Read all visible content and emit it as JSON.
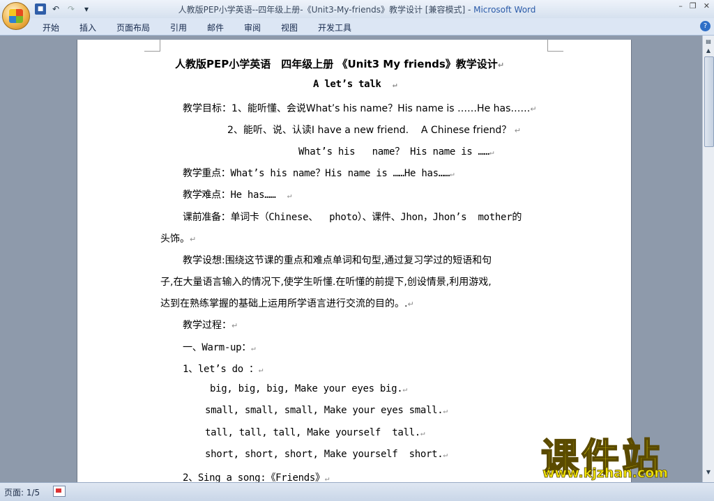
{
  "window": {
    "title": "人教版PEP小学英语--四年级上册-《Unit3-My-friends》教学设计 [兼容模式]",
    "title_sep": " - ",
    "app": "Microsoft Word"
  },
  "tabs": [
    "开始",
    "插入",
    "页面布局",
    "引用",
    "邮件",
    "审阅",
    "视图",
    "开发工具"
  ],
  "document": {
    "lines": [
      "人教版PEP小学英语　四年级上册 《Unit3 My friends》教学设计",
      "A let’s talk",
      "教学目标：1、能听懂、会说What’s his name？His name is ……He has……",
      "2、能听、说、认读I have a new friend.    A Chinese friend？",
      "What’s his   name？ His name is ……",
      "教学重点：What’s his name？His name is ……He has……",
      "教学难点：He has……",
      "课前准备：单词卡（Chinese、  photo）、课件、Jhon，Jhon’s  mother的",
      "头饰。",
      "教学设想:围绕这节课的重点和难点单词和句型,通过复习学过的短语和句",
      "子,在大量语言输入的情况下,使学生听懂.在听懂的前提下,创设情景,利用游戏,",
      "达到在熟练掌握的基础上运用所学语言进行交流的目的。.",
      "教学过程：",
      "一、Warm-up：",
      "1、let’s do ：",
      "big, big, big, Make your eyes big.",
      "small, small, small, Make your eyes small.",
      "tall, tall, tall, Make yourself  tall.",
      "short, short, short, Make yourself  short.",
      "2、Sing a song:《Friends》"
    ],
    "para_mark": "↵"
  },
  "status": {
    "page": "页面: 1/5"
  },
  "watermark": {
    "text": "课件站",
    "url": "www.kjzhan.com"
  }
}
